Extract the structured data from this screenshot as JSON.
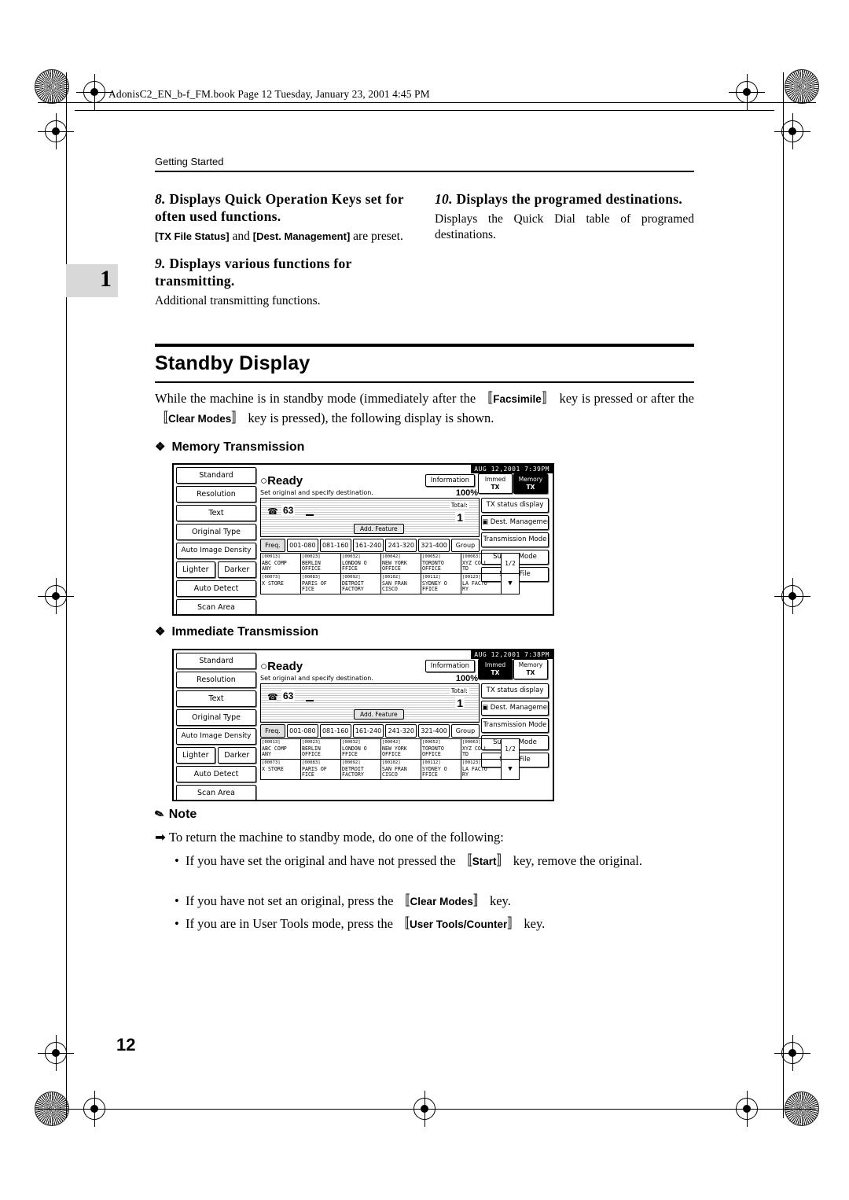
{
  "header": {
    "book_line": "AdonisC2_EN_b-f_FM.book  Page 12  Tuesday, January 23, 2001  4:45 PM",
    "running_head": "Getting Started",
    "chapter_tab": "1",
    "page_number": "12"
  },
  "items": {
    "item8_head_num": "8.",
    "item8_head_text": "Displays Quick Operation Keys set for often used functions.",
    "item8_body_pre": "[TX File Status]",
    "item8_body_mid": " and ",
    "item8_body_key2": "[Dest. Management]",
    "item8_body_post": " are preset.",
    "item9_head_num": "9.",
    "item9_head_text": "Displays various functions for transmitting.",
    "item9_body": "Additional transmitting functions.",
    "item10_head_num": "10.",
    "item10_head_text": "Displays the programed destinations.",
    "item10_body": "Displays the Quick Dial table of programed destinations."
  },
  "section": {
    "title": "Standby Display",
    "intro_part1": "While the machine is in standby mode (immediately after the ",
    "intro_key1": "Facsimile",
    "intro_part2": " key is pressed or after the ",
    "intro_key2": "Clear Modes",
    "intro_part3": " key is pressed), the following display is shown."
  },
  "subheads": {
    "memory": "Memory Transmission",
    "immediate": "Immediate Transmission"
  },
  "lcd_memory": {
    "clock": "AUG  12,2001  7:39PM",
    "status": "Ready",
    "instruction": "Set original and specify destination.",
    "information": "Information",
    "pct": "100%",
    "mode_immed_l1": "Immed",
    "mode_immed_l2": "TX",
    "mode_memory_l1": "Memory",
    "mode_memory_l2": "TX",
    "dest_number": "63",
    "total_label": "Total:",
    "total_value": "1",
    "add_feature": "Add. Feature",
    "right_buttons": [
      "TX status display",
      "Dest. Management",
      "Transmission Mode",
      "Sub TX Mode",
      "Store File"
    ],
    "freq_buttons": [
      "Freq.",
      "001-080",
      "081-160",
      "161-240",
      "241-320",
      "321-400",
      "Group"
    ],
    "left_buttons": [
      "Standard",
      "Resolution",
      "Text",
      "Original Type",
      "Auto Image Density",
      "Lighter",
      "Darker",
      "Auto Detect",
      "Scan Area"
    ],
    "page_indicator": "1/2",
    "quick_dial": [
      [
        {
          "code": "[00013]",
          "l1": "ABC COMP",
          "l2": "ANY"
        },
        {
          "code": "[00023]",
          "l1": "BERLIN",
          "l2": "OFFICE"
        },
        {
          "code": "[00032]",
          "l1": "LONDON O",
          "l2": "FFICE"
        },
        {
          "code": "[00042]",
          "l1": "NEW YORK",
          "l2": "OFFICE"
        },
        {
          "code": "[00052]",
          "l1": "TORONTO",
          "l2": "OFFICE"
        },
        {
          "code": "[00063]",
          "l1": "XYZ CO.L",
          "l2": "TD"
        }
      ],
      [
        {
          "code": "[00073]",
          "l1": "X STORE",
          "l2": ""
        },
        {
          "code": "[00083]",
          "l1": "PARIS OF",
          "l2": "FICE"
        },
        {
          "code": "[00092]",
          "l1": "DETROIT",
          "l2": "FACTORY"
        },
        {
          "code": "[00102]",
          "l1": "SAN FRAN",
          "l2": "CISCO"
        },
        {
          "code": "[00112]",
          "l1": "SYDNEY O",
          "l2": "FFICE"
        },
        {
          "code": "[00123]",
          "l1": "LA FACTO",
          "l2": "RY"
        }
      ]
    ]
  },
  "lcd_immediate": {
    "clock": "AUG  12,2001  7:38PM",
    "status": "Ready",
    "instruction": "Set original and specify destination.",
    "information": "Information",
    "pct": "100%",
    "mode_immed_l1": "Immed",
    "mode_immed_l2": "TX",
    "mode_memory_l1": "Memory",
    "mode_memory_l2": "TX",
    "dest_number": "63",
    "total_label": "Total:",
    "total_value": "1",
    "add_feature": "Add. Feature",
    "right_buttons": [
      "TX status display",
      "Dest. Management",
      "Transmission Mode",
      "Sub TX Mode",
      "Store File"
    ],
    "freq_buttons": [
      "Freq.",
      "001-080",
      "081-160",
      "161-240",
      "241-320",
      "321-400",
      "Group"
    ],
    "left_buttons": [
      "Standard",
      "Resolution",
      "Text",
      "Original Type",
      "Auto Image Density",
      "Lighter",
      "Darker",
      "Auto Detect",
      "Scan Area"
    ],
    "page_indicator": "1/2",
    "quick_dial": [
      [
        {
          "code": "[00013]",
          "l1": "ABC COMP",
          "l2": "ANY"
        },
        {
          "code": "[00023]",
          "l1": "BERLIN",
          "l2": "OFFICE"
        },
        {
          "code": "[00032]",
          "l1": "LONDON O",
          "l2": "FFICE"
        },
        {
          "code": "[00042]",
          "l1": "NEW YORK",
          "l2": "OFFICE"
        },
        {
          "code": "[00052]",
          "l1": "TORONTO",
          "l2": "OFFICE"
        },
        {
          "code": "[00063]",
          "l1": "XYZ CO.L",
          "l2": "TD"
        }
      ],
      [
        {
          "code": "[00073]",
          "l1": "X STORE",
          "l2": ""
        },
        {
          "code": "[00083]",
          "l1": "PARIS OF",
          "l2": "FICE"
        },
        {
          "code": "[00092]",
          "l1": "DETROIT",
          "l2": "FACTORY"
        },
        {
          "code": "[00102]",
          "l1": "SAN FRAN",
          "l2": "CISCO"
        },
        {
          "code": "[00112]",
          "l1": "SYDNEY O",
          "l2": "FFICE"
        },
        {
          "code": "[00123]",
          "l1": "LA FACTO",
          "l2": "RY"
        }
      ]
    ]
  },
  "note": {
    "title": "Note",
    "line1": "To return the machine to standby mode, do one of the following:",
    "b1_pre": "If you have set the original and have not pressed the ",
    "b1_key": "Start",
    "b1_post": " key, remove the original.",
    "b2_pre": "If you have not set an original, press the ",
    "b2_key": "Clear Modes",
    "b2_post": " key.",
    "b3_pre": "If you are in User Tools mode, press the ",
    "b3_key": "User Tools/Counter",
    "b3_post": " key."
  }
}
